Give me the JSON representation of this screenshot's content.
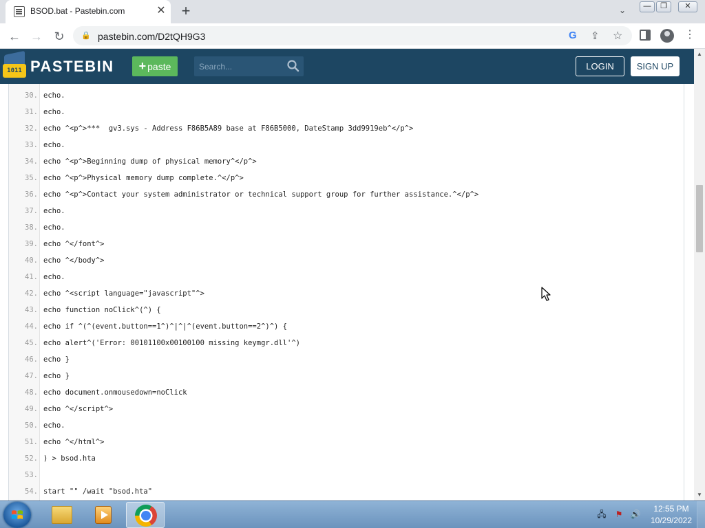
{
  "browser": {
    "tab_title": "BSOD.bat - Pastebin.com",
    "tab_close": "✕",
    "new_tab": "+",
    "tab_search": "⌄",
    "url": "pastebin.com/D2tQH9G3",
    "window_minimize": "—",
    "window_maximize": "❐",
    "window_close": "✕",
    "back": "←",
    "forward": "→",
    "reload": "↻",
    "menu": "⋮",
    "google_lens": "G",
    "share": "⇪",
    "bookmark": "☆",
    "lock": "🔒"
  },
  "header": {
    "brand": "PASTEBIN",
    "logo_text": "1011",
    "paste_label": "paste",
    "paste_plus": "+",
    "search_placeholder": "Search...",
    "login_label": "LOGIN",
    "signup_label": "SIGN UP",
    "background_color": "#1d4662",
    "paste_color": "#5cb85c"
  },
  "code_lines": [
    {
      "num": "30.",
      "text": "echo."
    },
    {
      "num": "31.",
      "text": "echo."
    },
    {
      "num": "32.",
      "text": "echo ^<p^>***  gv3.sys - Address F86B5A89 base at F86B5000, DateStamp 3dd9919eb^</p^>"
    },
    {
      "num": "33.",
      "text": "echo."
    },
    {
      "num": "34.",
      "text": "echo ^<p^>Beginning dump of physical memory^</p^>"
    },
    {
      "num": "35.",
      "text": "echo ^<p^>Physical memory dump complete.^</p^>"
    },
    {
      "num": "36.",
      "text": "echo ^<p^>Contact your system administrator or technical support group for further assistance.^</p^>"
    },
    {
      "num": "37.",
      "text": "echo."
    },
    {
      "num": "38.",
      "text": "echo."
    },
    {
      "num": "39.",
      "text": "echo ^</font^>"
    },
    {
      "num": "40.",
      "text": "echo ^</body^>"
    },
    {
      "num": "41.",
      "text": "echo."
    },
    {
      "num": "42.",
      "text": "echo ^<script language=\"javascript\"^>"
    },
    {
      "num": "43.",
      "text": "echo function noClick^(^) {"
    },
    {
      "num": "44.",
      "text": "echo if ^(^(event.button==1^)^|^|^(event.button==2^)^) {"
    },
    {
      "num": "45.",
      "text": "echo alert^('Error: 00101100x00100100 missing keymgr.dll'^)"
    },
    {
      "num": "46.",
      "text": "echo }"
    },
    {
      "num": "47.",
      "text": "echo }"
    },
    {
      "num": "48.",
      "text": "echo document.onmousedown=noClick"
    },
    {
      "num": "49.",
      "text": "echo ^</script^>"
    },
    {
      "num": "50.",
      "text": "echo."
    },
    {
      "num": "51.",
      "text": "echo ^</html^>"
    },
    {
      "num": "52.",
      "text": ") > bsod.hta"
    },
    {
      "num": "53.",
      "text": ""
    },
    {
      "num": "54.",
      "text": "start \"\" /wait \"bsod.hta\""
    }
  ],
  "scrollbar": {
    "up_arrow": "▲",
    "down_arrow": "▼"
  },
  "taskbar": {
    "time": "12:55 PM",
    "date": "10/29/2022",
    "network": "🖧",
    "flag": "⚑",
    "volume": "🔊"
  }
}
